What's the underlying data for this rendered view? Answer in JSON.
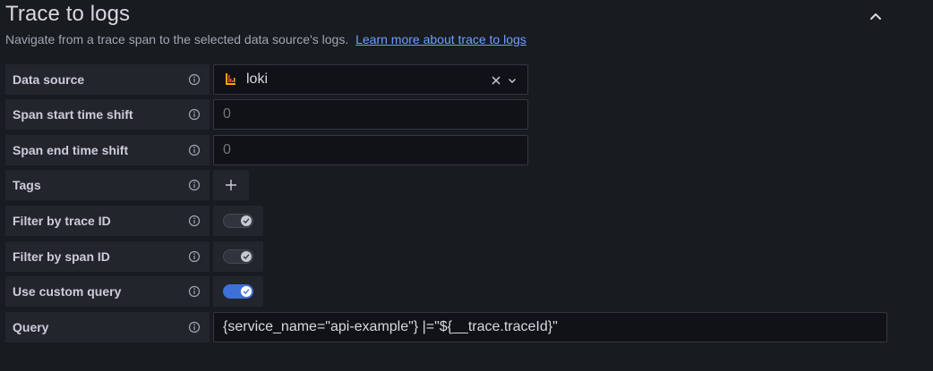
{
  "section": {
    "title": "Trace to logs",
    "description": "Navigate from a trace span to the selected data source's logs.",
    "learn_more": "Learn more about trace to logs"
  },
  "fields": {
    "data_source": {
      "label": "Data source",
      "value": "loki"
    },
    "span_start": {
      "label": "Span start time shift",
      "placeholder": "0"
    },
    "span_end": {
      "label": "Span end time shift",
      "placeholder": "0"
    },
    "tags": {
      "label": "Tags"
    },
    "filter_trace": {
      "label": "Filter by trace ID",
      "checked": true
    },
    "filter_span": {
      "label": "Filter by span ID",
      "checked": true
    },
    "custom_query": {
      "label": "Use custom query",
      "checked": true
    },
    "query": {
      "label": "Query",
      "value": "{service_name=\"api-example\"} |=\"${__trace.traceId}\""
    }
  },
  "colors": {
    "accent": "#3d71d9",
    "link": "#6e9fff",
    "panel": "#22252b",
    "input_bg": "#111217"
  },
  "icons": [
    "chevron-up-icon",
    "info-icon",
    "loki-logo-icon",
    "clear-icon",
    "chevron-down-icon",
    "plus-icon",
    "check-icon"
  ]
}
